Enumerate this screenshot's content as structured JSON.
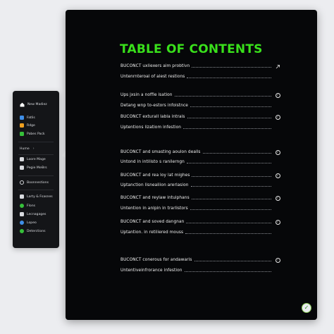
{
  "sidebar": {
    "items": [
      {
        "label": "New Madiez",
        "icon": "home-icon",
        "color": "#ffffff"
      },
      {
        "label": "Fatlis",
        "icon": "tasks-icon",
        "color": "#3f8fe8"
      },
      {
        "label": "Rdge",
        "icon": "box-icon",
        "color": "#f0a020"
      },
      {
        "label": "Pabes Pack",
        "icon": "pages-icon",
        "color": "#36c03a"
      },
      {
        "label": "Hume",
        "icon": "",
        "color": ""
      },
      {
        "label": "Loore Mage",
        "icon": "folder-icon",
        "color": "#d8dade"
      },
      {
        "label": "Pegie MeΘrs",
        "icon": "page-icon",
        "color": "#d8dade"
      },
      {
        "label": "Boonnestions",
        "icon": "settings-icon",
        "color": "#d8dade"
      },
      {
        "label": "Larty & Fsasnes",
        "icon": "layers-icon",
        "color": "#d8dade"
      },
      {
        "label": "Flons",
        "icon": "flow-icon",
        "color": "#36c03a"
      },
      {
        "label": "Lecnagages",
        "icon": "grid-icon",
        "color": "#d8dade"
      },
      {
        "label": "Lopeo",
        "icon": "logo-icon",
        "color": "#3f8fe8"
      },
      {
        "label": "Deterctions",
        "icon": "detection-icon",
        "color": "#36c03a"
      }
    ]
  },
  "document": {
    "title": "TABLE OF CONTENTS",
    "title_color": "#39e01b",
    "entries": [
      {
        "text": "BUCONCT uxliexers aim probtivn",
        "icon": "arrow-icon"
      },
      {
        "text": "Untenrnteroal of alest restions",
        "icon": ""
      },
      {
        "text": "Ups jxsin a noffle isation",
        "icon": "check-circle-icon"
      },
      {
        "text": "Detang wnp to-estors infoistnce",
        "icon": ""
      },
      {
        "text": "BUCONCT exturalI labla intrais",
        "icon": "check-circle-icon"
      },
      {
        "text": "Uptentions lizatiom infestion",
        "icon": ""
      },
      {
        "text": "BUCONCT and smasting aoulon dealls",
        "icon": "check-circle-icon"
      },
      {
        "text": "Untond in intilisto s ranilerngn",
        "icon": ""
      },
      {
        "text": "BUCONCT and rea loy lat mighes",
        "icon": "check-circle-icon"
      },
      {
        "text": "Uptanction lisnealiion arerlasion",
        "icon": ""
      },
      {
        "text": "BUCONCT and reylaw intuiphans",
        "icon": "check-circle-icon"
      },
      {
        "text": "Untention in anlpin in trarlistors",
        "icon": ""
      },
      {
        "text": "BUCONCT and soved dangnan",
        "icon": "check-circle-icon"
      },
      {
        "text": "Uptantion. in retiliered mouss",
        "icon": ""
      },
      {
        "text": "BUCONCT conerous for andawaris",
        "icon": "arrow-circle-icon"
      },
      {
        "text": "Untentiveinfrorance infestion",
        "icon": ""
      }
    ],
    "badge_icon": "check-badge-icon"
  }
}
